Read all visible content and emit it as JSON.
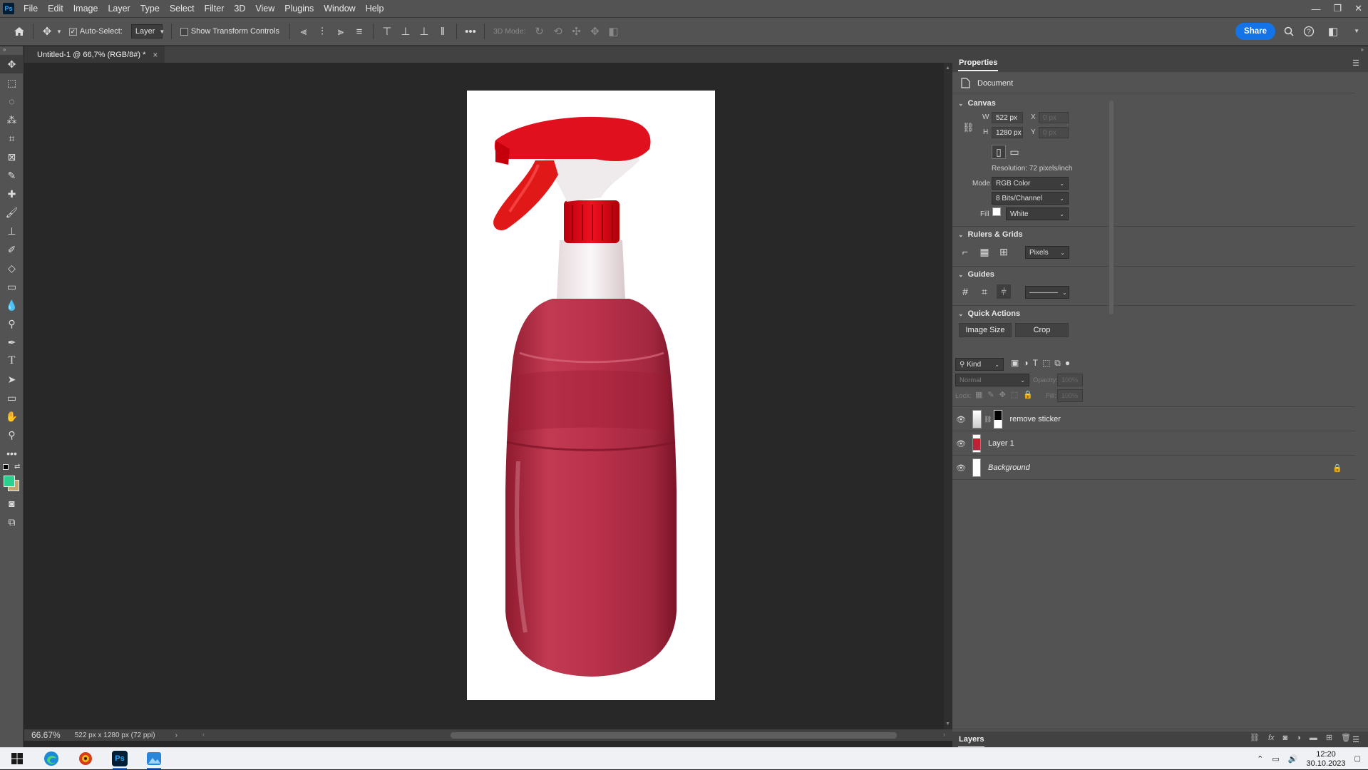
{
  "app": {
    "logo": "Ps"
  },
  "menu": [
    "File",
    "Edit",
    "Image",
    "Layer",
    "Type",
    "Select",
    "Filter",
    "3D",
    "View",
    "Plugins",
    "Window",
    "Help"
  ],
  "window_controls": {
    "minimize": "—",
    "restore": "❐",
    "close": "✕"
  },
  "options_bar": {
    "auto_select_label": "Auto-Select:",
    "auto_select_target": "Layer",
    "show_transform_label": "Show Transform Controls",
    "mode_3d_label": "3D Mode:",
    "share_label": "Share"
  },
  "document_tab": {
    "title": "Untitled-1 @ 66,7% (RGB/8#) *",
    "close": "×"
  },
  "status": {
    "zoom": "66.67%",
    "doc_info": "522 px x 1280 px (72 ppi)"
  },
  "properties": {
    "panel_title": "Properties",
    "doc_label": "Document",
    "canvas": {
      "title": "Canvas",
      "w_label": "W",
      "w_value": "522 px",
      "h_label": "H",
      "h_value": "1280 px",
      "x_label": "X",
      "x_value": "0 px",
      "y_label": "Y",
      "y_value": "0 px",
      "resolution": "Resolution: 72 pixels/inch",
      "mode_label": "Mode",
      "mode_value": "RGB Color",
      "bits_value": "8 Bits/Channel",
      "fill_label": "Fill",
      "fill_value": "White"
    },
    "rulers": {
      "title": "Rulers & Grids",
      "units": "Pixels"
    },
    "guides": {
      "title": "Guides",
      "style": "————"
    },
    "quick_actions": {
      "title": "Quick Actions",
      "image_size": "Image Size",
      "crop": "Crop"
    }
  },
  "layers": {
    "panel_title": "Layers",
    "filter_kind": "Kind",
    "blend_mode": "Normal",
    "opacity_label": "Opacity:",
    "opacity_value": "100%",
    "lock_label": "Lock:",
    "fill_label": "Fill:",
    "fill_value": "100%",
    "items": [
      {
        "name": "remove sticker"
      },
      {
        "name": "Layer 1"
      },
      {
        "name": "Background"
      }
    ]
  },
  "taskbar": {
    "time": "12:20",
    "date": "30.10.2023"
  },
  "colors": {
    "foreground": "#2ad18e",
    "background": "#c4a46a",
    "accent": "#1473e6"
  }
}
